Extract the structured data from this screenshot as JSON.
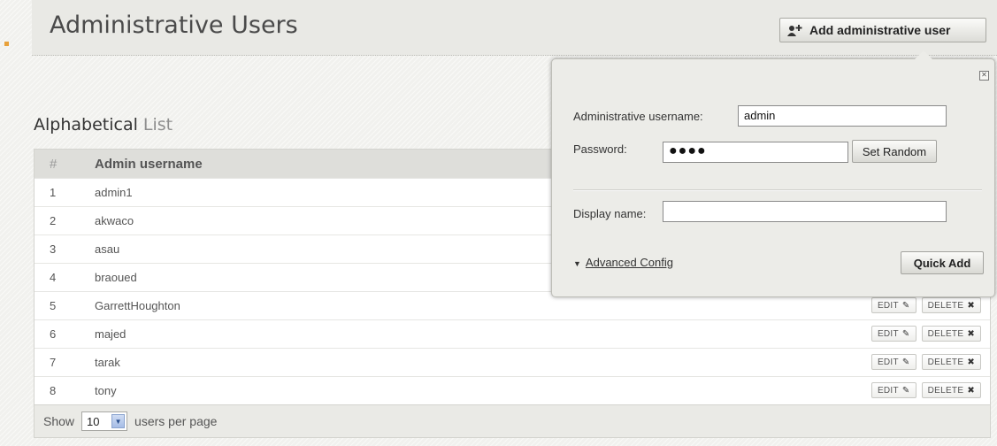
{
  "page": {
    "title": "Administrative Users",
    "add_button_label": "Add administrative user"
  },
  "list": {
    "title_word1": "Alphabetical",
    "title_word2": "List"
  },
  "table": {
    "headers": {
      "num": "#",
      "username": "Admin username"
    },
    "rows": [
      {
        "num": "1",
        "username": "admin1"
      },
      {
        "num": "2",
        "username": "akwaco"
      },
      {
        "num": "3",
        "username": "asau"
      },
      {
        "num": "4",
        "username": "braoued"
      },
      {
        "num": "5",
        "username": "GarrettHoughton"
      },
      {
        "num": "6",
        "username": "majed"
      },
      {
        "num": "7",
        "username": "tarak"
      },
      {
        "num": "8",
        "username": "tony"
      }
    ],
    "edit_label": "EDIT",
    "delete_label": "DELETE"
  },
  "footer": {
    "show_label": "Show",
    "per_page_value": "10",
    "users_per_page_label": "users per page"
  },
  "popup": {
    "username_label": "Administrative username:",
    "username_value": "admin",
    "password_label": "Password:",
    "password_value": "●●●●",
    "set_random_label": "Set Random",
    "display_name_label": "Display name:",
    "display_name_value": "",
    "advanced_config_label": "Advanced Config",
    "quick_add_label": "Quick Add"
  },
  "icons": {
    "add_user": "add-user-icon",
    "edit": "pencil-icon",
    "delete": "x-icon",
    "close": "close-icon",
    "dropdown": "chevron-down-icon",
    "expand": "triangle-down-icon"
  },
  "colors": {
    "accent": "#e8a13a",
    "header_bg": "#e9e9e5",
    "table_header_bg": "#dededa"
  }
}
